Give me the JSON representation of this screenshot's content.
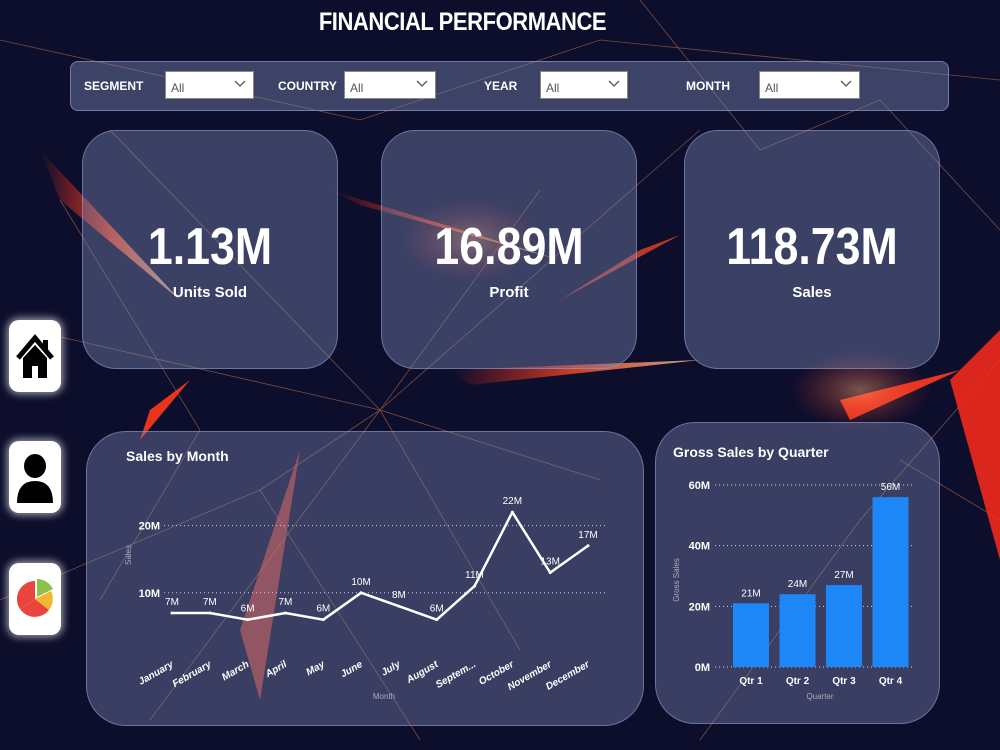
{
  "page": {
    "title": "FINANCIAL PERFORMANCE"
  },
  "filters": [
    {
      "label": "SEGMENT",
      "value": "All"
    },
    {
      "label": "COUNTRY",
      "value": "All"
    },
    {
      "label": "YEAR",
      "value": "All"
    },
    {
      "label": "MONTH",
      "value": "All"
    }
  ],
  "kpis": [
    {
      "value": "1.13M",
      "label": "Units Sold"
    },
    {
      "value": "16.89M",
      "label": "Profit"
    },
    {
      "value": "118.73M",
      "label": "Sales"
    }
  ],
  "nav": [
    {
      "icon": "home-icon"
    },
    {
      "icon": "user-icon"
    },
    {
      "icon": "pie-chart-icon"
    }
  ],
  "colors": {
    "background": "#0d0e2c",
    "bar": "#1e87f8",
    "line": "#ffffff",
    "accent": "#ff3a22"
  },
  "chart_data": [
    {
      "type": "line",
      "title": "Sales by Month",
      "xlabel": "Month",
      "ylabel": "Sales",
      "categories": [
        "January",
        "February",
        "March",
        "April",
        "May",
        "June",
        "July",
        "August",
        "Septem...",
        "October",
        "November",
        "December"
      ],
      "values": [
        7,
        7,
        6,
        7,
        6,
        10,
        8,
        6,
        11,
        22,
        13,
        17
      ],
      "data_labels": [
        "7M",
        "7M",
        "6M",
        "7M",
        "6M",
        "10M",
        "8M",
        "6M",
        "11M",
        "22M",
        "13M",
        "17M"
      ],
      "y_ticks": [
        "10M",
        "20M"
      ],
      "y_tick_values": [
        10,
        20
      ],
      "ylim": [
        0,
        25
      ],
      "grid": true
    },
    {
      "type": "bar",
      "title": "Gross Sales by Quarter",
      "xlabel": "Quarter",
      "ylabel": "Gross Sales",
      "categories": [
        "Qtr 1",
        "Qtr 2",
        "Qtr 3",
        "Qtr 4"
      ],
      "values": [
        21,
        24,
        27,
        56
      ],
      "data_labels": [
        "21M",
        "24M",
        "27M",
        "56M"
      ],
      "y_ticks": [
        "0M",
        "20M",
        "40M",
        "60M"
      ],
      "y_tick_values": [
        0,
        20,
        40,
        60
      ],
      "ylim": [
        0,
        60
      ],
      "grid": true
    }
  ]
}
